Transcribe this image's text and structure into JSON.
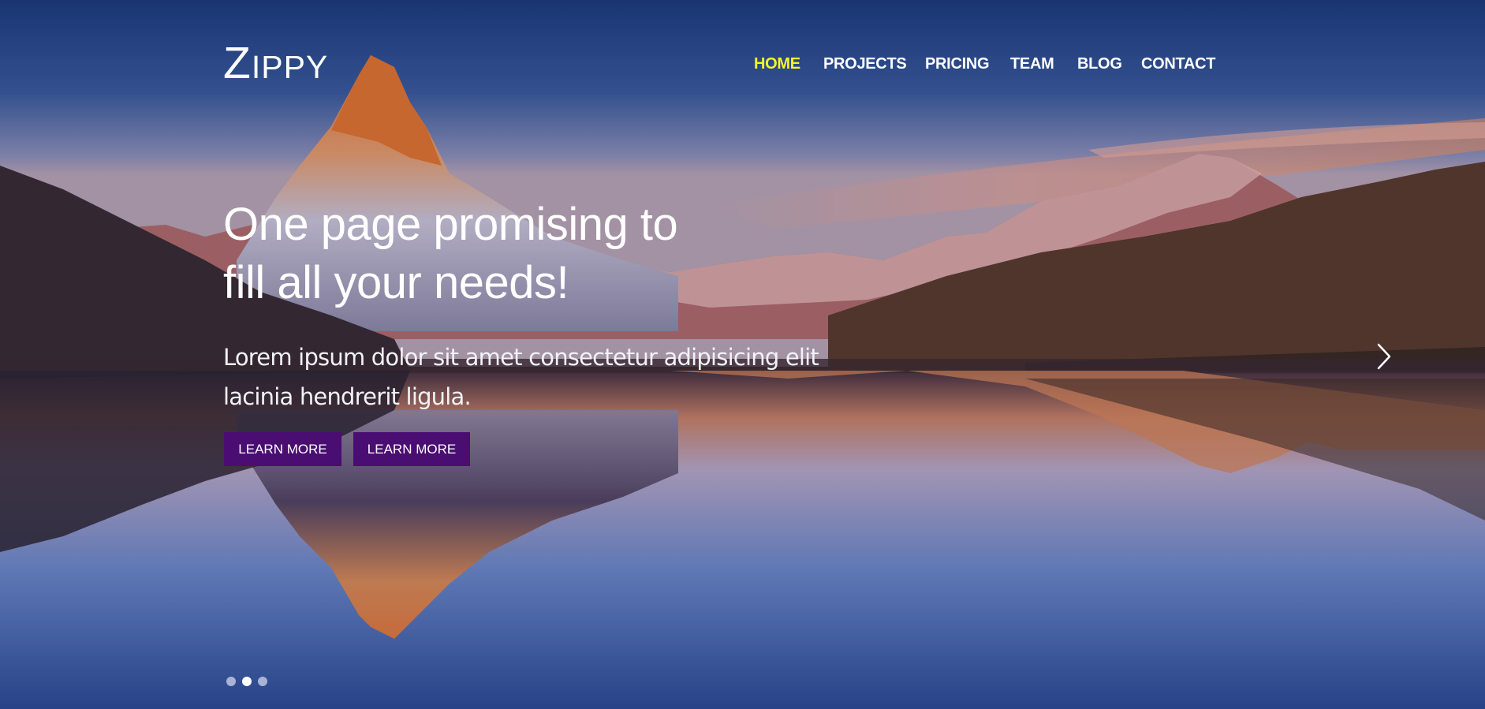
{
  "logo": {
    "first_letter": "Z",
    "rest": "IPPY"
  },
  "nav": {
    "items": [
      {
        "label": "HOME",
        "active": true
      },
      {
        "label": "PROJECTS",
        "active": false
      },
      {
        "label": "PRICING",
        "active": false
      },
      {
        "label": "TEAM",
        "active": false
      },
      {
        "label": "BLOG",
        "active": false
      },
      {
        "label": "CONTACT",
        "active": false
      }
    ]
  },
  "hero": {
    "headline_line1": "One page promising to",
    "headline_line2": "fill all your needs!",
    "lead_line1": "Lorem ipsum dolor sit amet consectetur adipisicing elit",
    "lead_line2": "lacinia hendrerit ligula.",
    "buttons": [
      {
        "label": "LEARN MORE"
      },
      {
        "label": "LEARN MORE"
      }
    ]
  },
  "slider": {
    "next_icon": "chevron-right-icon",
    "slide_count": 3,
    "active_slide": 2
  },
  "colors": {
    "accent_nav": "#f5f52a",
    "button_bg": "#4a0d72",
    "text": "#ffffff"
  }
}
